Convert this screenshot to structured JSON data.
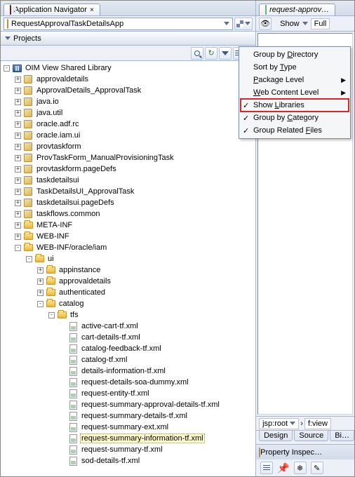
{
  "left": {
    "tab": {
      "icon": "navigator-icon",
      "label": "Application Navigator"
    },
    "app_selector": {
      "icon": "application-icon",
      "value": "RequestApprovalTaskDetailsApp"
    },
    "section_header": "Projects",
    "tree": [
      {
        "d": 0,
        "exp": "-",
        "icon": "lib",
        "label": "OIM View Shared Library",
        "sel": false
      },
      {
        "d": 1,
        "exp": "+",
        "icon": "pkg",
        "label": "approvaldetails"
      },
      {
        "d": 1,
        "exp": "+",
        "icon": "pkg",
        "label": "ApprovalDetails_ApprovalTask"
      },
      {
        "d": 1,
        "exp": "+",
        "icon": "pkg",
        "label": "java.io"
      },
      {
        "d": 1,
        "exp": "+",
        "icon": "pkg",
        "label": "java.util"
      },
      {
        "d": 1,
        "exp": "+",
        "icon": "pkg",
        "label": "oracle.adf.rc"
      },
      {
        "d": 1,
        "exp": "+",
        "icon": "pkg",
        "label": "oracle.iam.ui"
      },
      {
        "d": 1,
        "exp": "+",
        "icon": "pkg",
        "label": "provtaskform"
      },
      {
        "d": 1,
        "exp": "+",
        "icon": "pkg",
        "label": "ProvTaskForm_ManualProvisioningTask"
      },
      {
        "d": 1,
        "exp": "+",
        "icon": "pkg",
        "label": "provtaskform.pageDefs"
      },
      {
        "d": 1,
        "exp": "+",
        "icon": "pkg",
        "label": "taskdetailsui"
      },
      {
        "d": 1,
        "exp": "+",
        "icon": "pkg",
        "label": "TaskDetailsUI_ApprovalTask"
      },
      {
        "d": 1,
        "exp": "+",
        "icon": "pkg",
        "label": "taskdetailsui.pageDefs"
      },
      {
        "d": 1,
        "exp": "+",
        "icon": "pkg",
        "label": "taskflows.common"
      },
      {
        "d": 1,
        "exp": "+",
        "icon": "folder",
        "label": "META-INF"
      },
      {
        "d": 1,
        "exp": "+",
        "icon": "folder",
        "label": "WEB-INF"
      },
      {
        "d": 1,
        "exp": "-",
        "icon": "folder",
        "label": "WEB-INF/oracle/iam"
      },
      {
        "d": 2,
        "exp": "-",
        "icon": "folder",
        "label": "ui"
      },
      {
        "d": 3,
        "exp": "+",
        "icon": "folder",
        "label": "appinstance"
      },
      {
        "d": 3,
        "exp": "+",
        "icon": "folder",
        "label": "approvaldetails"
      },
      {
        "d": 3,
        "exp": "+",
        "icon": "folder",
        "label": "authenticated"
      },
      {
        "d": 3,
        "exp": "-",
        "icon": "folder",
        "label": "catalog"
      },
      {
        "d": 4,
        "exp": "-",
        "icon": "folder",
        "label": "tfs"
      },
      {
        "d": 5,
        "exp": "",
        "icon": "xml",
        "label": "active-cart-tf.xml"
      },
      {
        "d": 5,
        "exp": "",
        "icon": "xml",
        "label": "cart-details-tf.xml"
      },
      {
        "d": 5,
        "exp": "",
        "icon": "xml",
        "label": "catalog-feedback-tf.xml"
      },
      {
        "d": 5,
        "exp": "",
        "icon": "xml",
        "label": "catalog-tf.xml"
      },
      {
        "d": 5,
        "exp": "",
        "icon": "xml",
        "label": "details-information-tf.xml"
      },
      {
        "d": 5,
        "exp": "",
        "icon": "xml",
        "label": "request-details-soa-dummy.xml"
      },
      {
        "d": 5,
        "exp": "",
        "icon": "xml",
        "label": "request-entity-tf.xml"
      },
      {
        "d": 5,
        "exp": "",
        "icon": "xml",
        "label": "request-summary-approval-details-tf.xml"
      },
      {
        "d": 5,
        "exp": "",
        "icon": "xml",
        "label": "request-summary-details-tf.xml"
      },
      {
        "d": 5,
        "exp": "",
        "icon": "xml",
        "label": "request-summary-ext.xml"
      },
      {
        "d": 5,
        "exp": "",
        "icon": "xml",
        "label": "request-summary-information-tf.xml",
        "sel": true
      },
      {
        "d": 5,
        "exp": "",
        "icon": "xml",
        "label": "request-summary-tf.xml"
      },
      {
        "d": 5,
        "exp": "",
        "icon": "xml",
        "label": "sod-details-tf.xml"
      }
    ]
  },
  "context_menu": {
    "items": [
      {
        "label": "Group by Directory",
        "underline": "D",
        "checked": false,
        "sub": false
      },
      {
        "label": "Sort by Type",
        "underline": "T",
        "checked": false,
        "sub": false
      },
      {
        "label": "Package Level",
        "underline": "P",
        "checked": false,
        "sub": true
      },
      {
        "label": "Web Content Level",
        "underline": "W",
        "checked": false,
        "sub": true
      },
      {
        "label": "Show Libraries",
        "underline": "L",
        "checked": true,
        "sub": false,
        "hilite": true
      },
      {
        "label": "Group by Category",
        "underline": "C",
        "checked": true,
        "sub": false
      },
      {
        "label": "Group Related Files",
        "underline": "F",
        "checked": true,
        "sub": false
      }
    ]
  },
  "right": {
    "tab_label": "request-approv…",
    "show_label": "Show",
    "full_label": "Full",
    "breadcrumb": [
      "jsp:root",
      "f:view"
    ],
    "bottom_tabs": [
      "Design",
      "Source",
      "Bi…"
    ],
    "prop_header": "Property Inspec…"
  }
}
